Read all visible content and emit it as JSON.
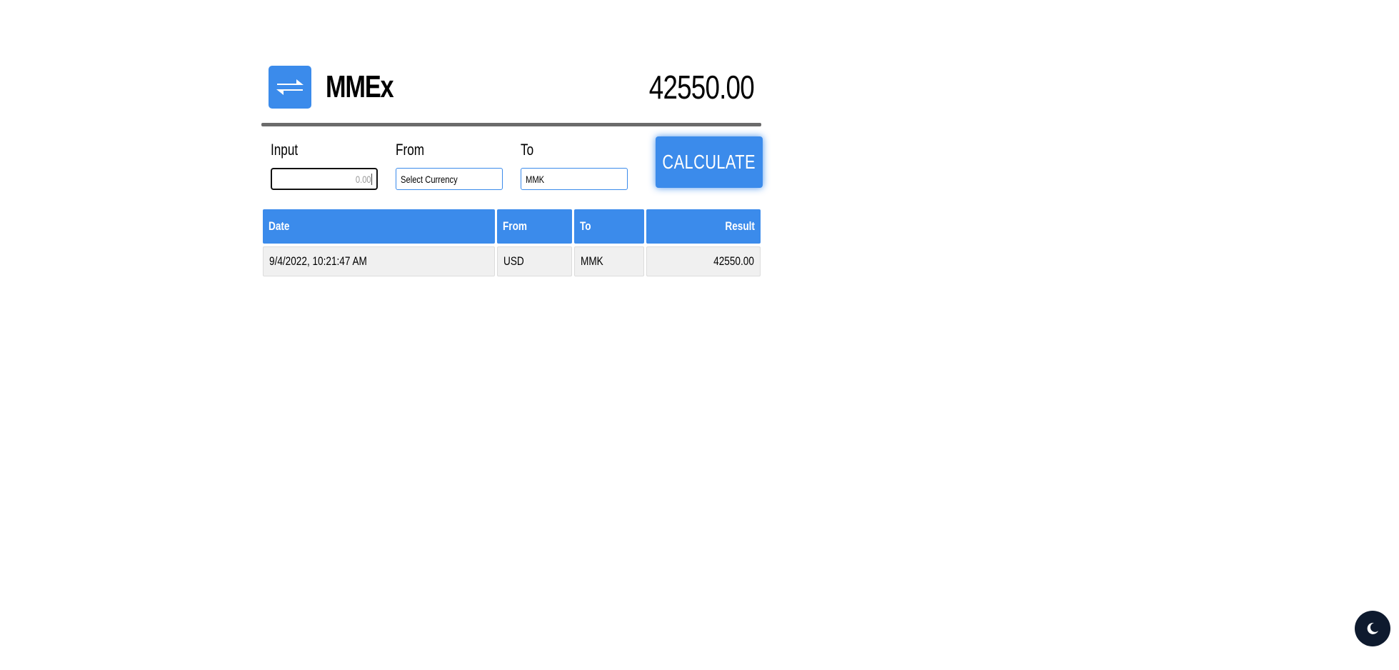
{
  "app": {
    "name": "MMEx",
    "total": "42550.00",
    "logo_icon": "exchange-arrows-icon",
    "accent_color": "#3b8beb"
  },
  "form": {
    "input_label": "Input",
    "input_value": "0.00",
    "from_label": "From",
    "from_value": "Select Currency",
    "to_label": "To",
    "to_value": "MMK",
    "calculate_label": "CALCULATE"
  },
  "table": {
    "headers": {
      "date": "Date",
      "from": "From",
      "to": "To",
      "result": "Result"
    },
    "rows": [
      {
        "date": "9/4/2022, 10:21:47 AM",
        "from": "USD",
        "to": "MMK",
        "result": "42550.00"
      }
    ]
  },
  "theme_toggle": {
    "icon": "moon-icon"
  }
}
